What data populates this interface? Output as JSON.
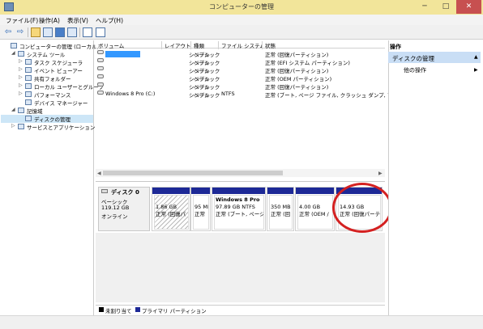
{
  "window": {
    "title": "コンピューターの管理",
    "minimize": "─",
    "maximize": "□",
    "close": "✕"
  },
  "menu": [
    "ファイル(F)",
    "操作(A)",
    "表示(V)",
    "ヘルプ(H)"
  ],
  "toolbar": {
    "back": "⇦",
    "forward": "⇨"
  },
  "tree": [
    {
      "label": "コンピューターの管理 (ローカル)",
      "indent": 0,
      "exp": ""
    },
    {
      "label": "システム ツール",
      "indent": 1,
      "exp": "◢"
    },
    {
      "label": "タスク スケジューラ",
      "indent": 2,
      "exp": "▷"
    },
    {
      "label": "イベント ビューアー",
      "indent": 2,
      "exp": "▷"
    },
    {
      "label": "共有フォルダー",
      "indent": 2,
      "exp": "▷"
    },
    {
      "label": "ローカル ユーザーとグループ",
      "indent": 2,
      "exp": "▷"
    },
    {
      "label": "パフォーマンス",
      "indent": 2,
      "exp": "▷"
    },
    {
      "label": "デバイス マネージャー",
      "indent": 2,
      "exp": ""
    },
    {
      "label": "記憶域",
      "indent": 1,
      "exp": "◢"
    },
    {
      "label": "ディスクの管理",
      "indent": 2,
      "exp": "",
      "selected": true
    },
    {
      "label": "サービスとアプリケーション",
      "indent": 1,
      "exp": "▷"
    }
  ],
  "columns": [
    "ボリューム",
    "レイアウト",
    "種類",
    "ファイル システム",
    "状態"
  ],
  "volumes": [
    {
      "volume": "",
      "layout": "シンプル",
      "type": "ベーシック",
      "fs": "",
      "status": "正常 (回復パーティション)",
      "highlight": true
    },
    {
      "volume": "",
      "layout": "シンプル",
      "type": "ベーシック",
      "fs": "",
      "status": "正常 (EFI システム パーティション)"
    },
    {
      "volume": "",
      "layout": "シンプル",
      "type": "ベーシック",
      "fs": "",
      "status": "正常 (回復パーティション)"
    },
    {
      "volume": "",
      "layout": "シンプル",
      "type": "ベーシック",
      "fs": "",
      "status": "正常 (OEM パーティション)"
    },
    {
      "volume": "",
      "layout": "シンプル",
      "type": "ベーシック",
      "fs": "",
      "status": "正常 (回復パーティション)"
    },
    {
      "volume": "Windows 8 Pro (C:)",
      "layout": "シンプル",
      "type": "ベーシック",
      "fs": "NTFS",
      "status": "正常 (ブート, ページ ファイル, クラッシュ ダンプ, プライ"
    }
  ],
  "disk": {
    "name": "ディスク 0",
    "type": "ベーシック",
    "size": "119.12 GB",
    "state": "オンライン"
  },
  "partitions": [
    {
      "name": "",
      "line1": "1.86 GB",
      "line2": "正常 (回復パ",
      "striped": true
    },
    {
      "name": "",
      "line1": "95 MI",
      "line2": "正常"
    },
    {
      "name": "Windows 8 Pro",
      "line1": "97.89 GB NTFS",
      "line2": "正常 (ブート, ページ"
    },
    {
      "name": "",
      "line1": "350 MB",
      "line2": "正常 (回"
    },
    {
      "name": "",
      "line1": "4.00 GB",
      "line2": "正常 (OEM /"
    },
    {
      "name": "",
      "line1": "14.93 GB",
      "line2": "正常 (回復パーテ"
    }
  ],
  "legend": {
    "unallocated": "未割り当て",
    "primary": "プライマリ パーティション"
  },
  "actions": {
    "header": "操作",
    "section": "ディスクの管理",
    "other": "他の操作"
  },
  "colors": {
    "titlebar": "#f2e59a",
    "partition_bar": "#1d2996",
    "highlight_circle": "#d42121",
    "selection": "#cde6f7"
  }
}
